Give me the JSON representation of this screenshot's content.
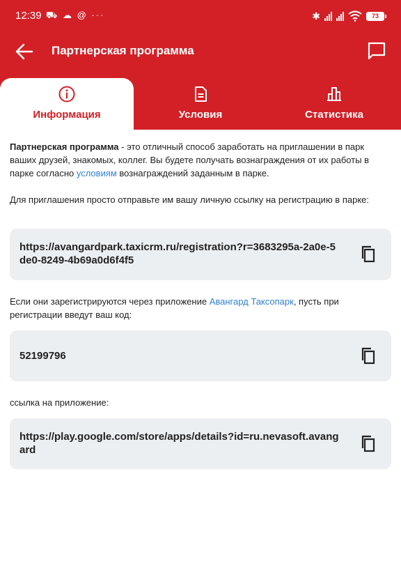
{
  "status_bar": {
    "time": "12:39",
    "left_icons": "⛟ ☁ @ ···",
    "battery": "73"
  },
  "app_bar": {
    "title": "Партнерская программа",
    "back_icon": "arrow-left-icon",
    "chat_icon": "chat-bubble-icon"
  },
  "tabs": [
    {
      "label": "Информация",
      "icon": "info-icon",
      "active": true
    },
    {
      "label": "Условия",
      "icon": "document-icon",
      "active": false
    },
    {
      "label": "Статистика",
      "icon": "bar-chart-icon",
      "active": false
    }
  ],
  "intro": {
    "bold": "Партнерская программа",
    "text1": " - это отличный способ заработать на приглашении в парк ваших друзей, знакомых, коллег. Вы будете получать вознаграждения от их работы в парке согласно ",
    "link": "условиям",
    "text2": " вознаграждений заданным в парке."
  },
  "invite_text": "Для приглашения просто отправьте им вашу личную ссылку на регистрацию в парке:",
  "registration_link": "https://avangardpark.taxicrm.ru/registration?r=3683295a-2a0e-5de0-8249-4b69a0d6f4f5",
  "code_intro": {
    "text1": "Если они зарегистрируются через приложение ",
    "link": "Авангард Таксопарк",
    "text2": ", пусть при регистрации введут ваш код:"
  },
  "code": "52199796",
  "app_link_label": "ссылка на приложение:",
  "app_link": "https://play.google.com/store/apps/details?id=ru.nevasoft.avangard",
  "colors": {
    "brand_red": "#d32027",
    "card_bg": "#eceff2",
    "link_blue": "#2f7fd1"
  }
}
